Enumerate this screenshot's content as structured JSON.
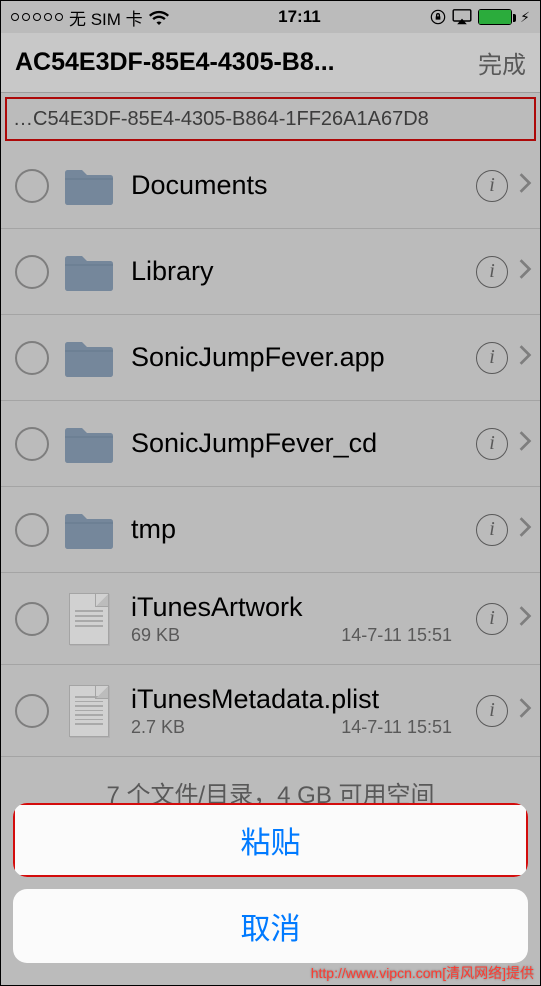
{
  "status": {
    "carrier": "无 SIM 卡",
    "time": "17:11"
  },
  "nav": {
    "title": "AC54E3DF-85E4-4305-B8...",
    "done": "完成"
  },
  "path": "…C54E3DF-85E4-4305-B864-1FF26A1A67D8",
  "rows": [
    {
      "title": "Documents",
      "kind": "folder"
    },
    {
      "title": "Library",
      "kind": "folder"
    },
    {
      "title": "SonicJumpFever.app",
      "kind": "folder"
    },
    {
      "title": "SonicJumpFever_cd",
      "kind": "folder"
    },
    {
      "title": "tmp",
      "kind": "folder"
    },
    {
      "title": "iTunesArtwork",
      "kind": "file",
      "size": "69 KB",
      "date": "14-7-11 15:51"
    },
    {
      "title": "iTunesMetadata.plist",
      "kind": "file-dense",
      "size": "2.7 KB",
      "date": "14-7-11 15:51"
    }
  ],
  "summary": "7 个文件/目录，4 GB 可用空间",
  "sheet": {
    "paste": "粘贴",
    "cancel": "取消"
  },
  "info_glyph": "i",
  "watermark": "http://www.vipcn.com[清风网络]提供"
}
